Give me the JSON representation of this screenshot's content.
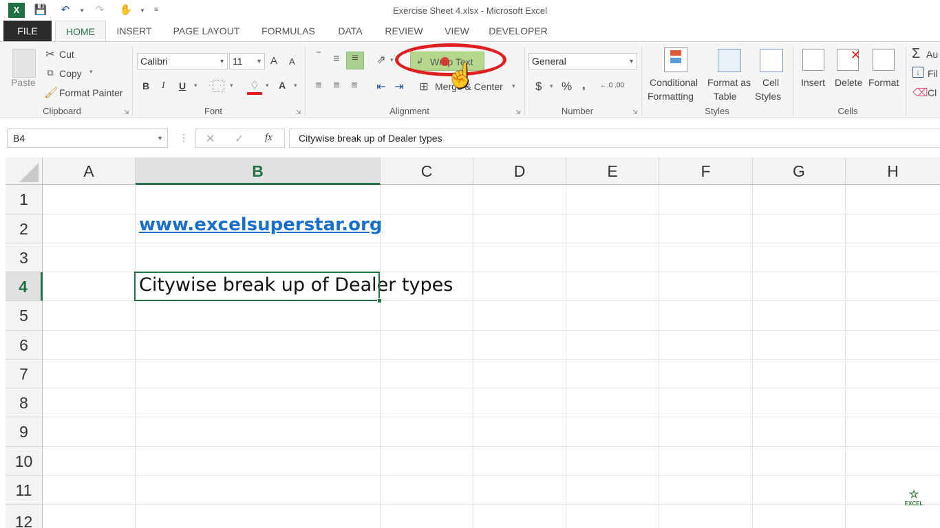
{
  "app": {
    "title": "Exercise Sheet 4.xlsx - Microsoft Excel"
  },
  "quick_access": {
    "icons": [
      "excel-logo-icon",
      "save-icon",
      "undo-icon",
      "redo-icon",
      "touch-mode-icon",
      "customize-icon"
    ]
  },
  "tabs": [
    "FILE",
    "HOME",
    "INSERT",
    "PAGE LAYOUT",
    "FORMULAS",
    "DATA",
    "REVIEW",
    "VIEW",
    "DEVELOPER"
  ],
  "ribbon": {
    "clipboard": {
      "paste": "Paste",
      "cut": "Cut",
      "copy": "Copy",
      "format_painter": "Format Painter",
      "label": "Clipboard"
    },
    "font": {
      "name": "Calibri",
      "size": "11",
      "bold": "B",
      "italic": "I",
      "underline": "U",
      "grow": "A",
      "shrink": "A",
      "color_a": "A",
      "label": "Font"
    },
    "alignment": {
      "wrap_text": "Wrap Text",
      "merge_center": "Merge & Center",
      "label": "Alignment"
    },
    "number": {
      "format": "General",
      "currency": "$",
      "percent": "%",
      "comma": ",",
      "inc_dec": "←.0 .00",
      "dec_dec": ".00 →.0",
      "label": "Number"
    },
    "styles": {
      "conditional_1": "Conditional",
      "conditional_2": "Formatting",
      "format_as_1": "Format as",
      "format_as_2": "Table",
      "cell_1": "Cell",
      "cell_2": "Styles",
      "label": "Styles"
    },
    "cells": {
      "insert": "Insert",
      "delete": "Delete",
      "format": "Format",
      "label": "Cells"
    },
    "editing": {
      "autosum": "Au",
      "fill": "Fil",
      "clear": "Cl"
    }
  },
  "formula_bar": {
    "name_box": "B4",
    "cancel": "✕",
    "enter": "✓",
    "fx": "fx",
    "formula": "Citywise break up of Dealer types"
  },
  "grid": {
    "columns": [
      "A",
      "B",
      "C",
      "D",
      "E",
      "F",
      "G",
      "H"
    ],
    "rows": [
      "1",
      "2",
      "3",
      "4",
      "5",
      "6",
      "7",
      "8",
      "9",
      "10",
      "11",
      "12"
    ],
    "selected_cell": "B4",
    "cells": {
      "B2": "www.excelsuperstar.org",
      "B4": "Citywise break up of Dealer types"
    }
  },
  "watermark": "EXCEL",
  "colors": {
    "accent": "#217346",
    "link": "#1a6fc9",
    "highlight_ring": "#e02020"
  }
}
